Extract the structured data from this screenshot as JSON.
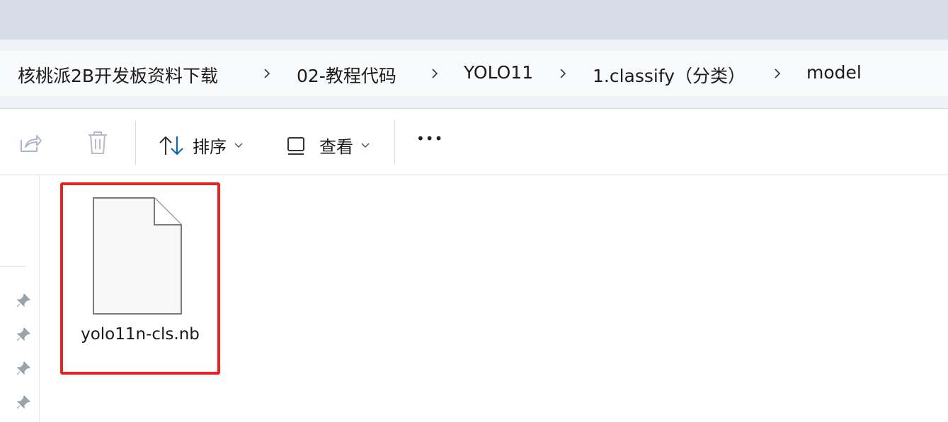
{
  "breadcrumb": {
    "items": [
      "核桃派2B开发板资料下载",
      "02-教程代码",
      "YOLO11",
      "1.classify（分类）",
      "model"
    ]
  },
  "toolbar": {
    "sort_label": "排序",
    "view_label": "查看",
    "more_label": "•••"
  },
  "files": [
    {
      "name": "yolo11n-cls.nb",
      "selected": true
    }
  ],
  "colors": {
    "accent": "#0067c0",
    "highlight_border": "#e8231f"
  }
}
